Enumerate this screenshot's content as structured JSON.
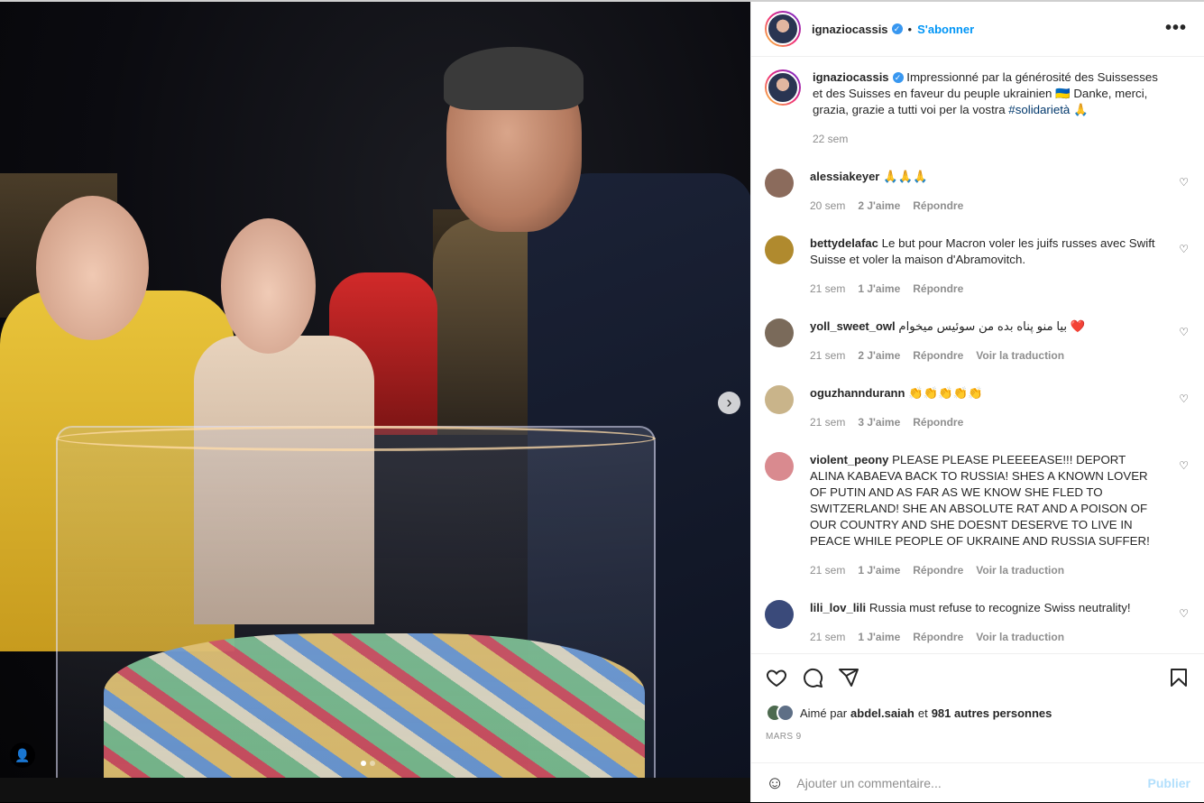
{
  "post": {
    "author": "ignaziocassis",
    "follow_label": "S'abonner",
    "dot": "•",
    "more_label": "•••",
    "caption_author": "ignaziocassis",
    "caption_text": "Impressionné par la générosité des Suissesses et des Suisses en faveur du peuple ukrainien 🇺🇦 Danke, merci, grazia, grazie a tutti voi per la vostra",
    "caption_hashtag": "#solidarietà",
    "caption_emoji": "🙏",
    "caption_time": "22 sem"
  },
  "comments": [
    {
      "user": "alessiakeyer",
      "text": "🙏🙏🙏",
      "time": "20 sem",
      "likes": "2 J'aime",
      "reply": "Répondre",
      "translate": "",
      "avatar_color": "#8b6b5c"
    },
    {
      "user": "bettydelafac",
      "text": "Le but pour Macron voler les juifs russes avec Swift Suisse et voler la maison d'Abramovitch.",
      "time": "21 sem",
      "likes": "1 J'aime",
      "reply": "Répondre",
      "translate": "",
      "avatar_color": "#b08a2e"
    },
    {
      "user": "yoll_sweet_owl",
      "text": "بيا منو پناه بده من سوئيس ميخوام ❤️",
      "time": "21 sem",
      "likes": "2 J'aime",
      "reply": "Répondre",
      "translate": "Voir la traduction",
      "avatar_color": "#7a6a5a"
    },
    {
      "user": "oguzhanndurann",
      "text": "👏👏👏👏👏",
      "time": "21 sem",
      "likes": "3 J'aime",
      "reply": "Répondre",
      "translate": "",
      "avatar_color": "#c9b48a"
    },
    {
      "user": "violent_peony",
      "text": "PLEASE PLEASE PLEEEEASE!!! DEPORT ALINA KABAEVA BACK TO RUSSIA! SHES A KNOWN LOVER OF PUTIN AND AS FAR AS WE KNOW SHE FLED TO SWITZERLAND! SHE AN ABSOLUTE RAT AND A POISON OF OUR COUNTRY AND SHE DOESNT DESERVE TO LIVE IN PEACE WHILE PEOPLE OF UKRAINE AND RUSSIA SUFFER!",
      "time": "21 sem",
      "likes": "1 J'aime",
      "reply": "Répondre",
      "translate": "Voir la traduction",
      "avatar_color": "#d98a8f"
    },
    {
      "user": "lili_lov_lili",
      "text": "Russia must refuse to recognize Swiss neutrality!",
      "time": "21 sem",
      "likes": "1 J'aime",
      "reply": "Répondre",
      "translate": "Voir la traduction",
      "avatar_color": "#3a4a7a"
    }
  ],
  "likes": {
    "prefix": "Aimé par",
    "user": "abdel.saiah",
    "and": "et",
    "others": "981 autres personnes"
  },
  "date": "MARS 9",
  "add_comment": {
    "placeholder": "Ajouter un commentaire...",
    "publish": "Publier"
  },
  "photo": {
    "next_glyph": "›",
    "tag_glyph": "👤"
  },
  "colors": {
    "accent": "#0095f6",
    "verified": "#3897f0",
    "muted": "#8e8e8e"
  }
}
